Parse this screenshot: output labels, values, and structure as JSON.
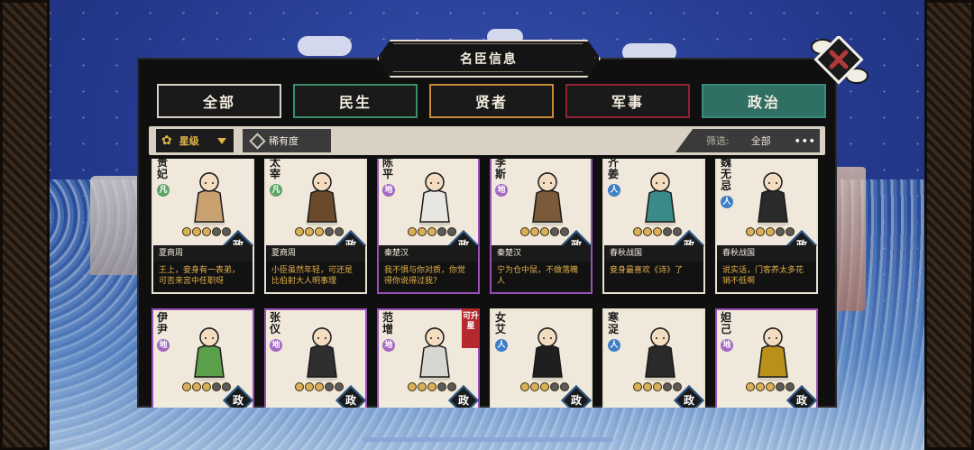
{
  "window_title": "名臣信息",
  "tabs": [
    "全部",
    "民生",
    "贤者",
    "军事",
    "政治"
  ],
  "active_tab": "政治",
  "filter": {
    "sort_star_label": "星级",
    "sort_rarity_label": "稀有度",
    "filter_label": "筛选:",
    "filter_value": "全部",
    "more": "•••"
  },
  "colors": {
    "accent_active_tab": "#2f6f64",
    "rarity_purple": "#9a4fb5",
    "quote_text": "#e3b04a"
  },
  "cards": [
    {
      "name": "贵妃",
      "badge": "凡",
      "badge_type": "feng",
      "stars": 3,
      "rarity": "white",
      "dynasty": "夏商周",
      "quote": "王上，妾身有一表弟，可否来宫中任职呀",
      "cat": "政"
    },
    {
      "name": "太宰",
      "badge": "凡",
      "badge_type": "feng",
      "stars": 3,
      "rarity": "white",
      "dynasty": "夏商周",
      "quote": "小臣虽然年轻，可还是比伯射大人明事理",
      "cat": "政"
    },
    {
      "name": "陈平",
      "badge": "地",
      "badge_type": "di",
      "stars": 3,
      "rarity": "purple",
      "dynasty": "秦楚汉",
      "quote": "我不惧与你对质，你觉得你说得过我？",
      "cat": "政"
    },
    {
      "name": "李斯",
      "badge": "地",
      "badge_type": "di",
      "stars": 3,
      "rarity": "purple",
      "dynasty": "秦楚汉",
      "quote": "宁为仓中鼠，不做落魄人",
      "cat": "政"
    },
    {
      "name": "齐姜",
      "badge": "人",
      "badge_type": "ren",
      "stars": 3,
      "rarity": "white",
      "dynasty": "春秋战国",
      "quote": "妾身最喜欢《诗》了",
      "cat": "政"
    },
    {
      "name": "魏无忌",
      "badge": "人",
      "badge_type": "ren",
      "stars": 3,
      "rarity": "white",
      "dynasty": "春秋战国",
      "quote": "说实话，门客养太多花销不低啊",
      "cat": "政"
    },
    {
      "name": "伊尹",
      "badge": "地",
      "badge_type": "di",
      "stars": 3,
      "rarity": "purple",
      "cat": "政"
    },
    {
      "name": "张仪",
      "badge": "地",
      "badge_type": "di",
      "stars": 3,
      "rarity": "purple",
      "cat": "政"
    },
    {
      "name": "范增",
      "badge": "地",
      "badge_type": "di",
      "stars": 3,
      "rarity": "purple",
      "upgrade": "可升星",
      "cat": "政"
    },
    {
      "name": "女艾",
      "badge": "人",
      "badge_type": "ren",
      "stars": 3,
      "rarity": "white",
      "cat": "政"
    },
    {
      "name": "寒浞",
      "badge": "人",
      "badge_type": "ren",
      "stars": 3,
      "rarity": "white",
      "cat": "政"
    },
    {
      "name": "妲己",
      "badge": "地",
      "badge_type": "di",
      "stars": 3,
      "rarity": "purple",
      "cat": "政"
    }
  ]
}
